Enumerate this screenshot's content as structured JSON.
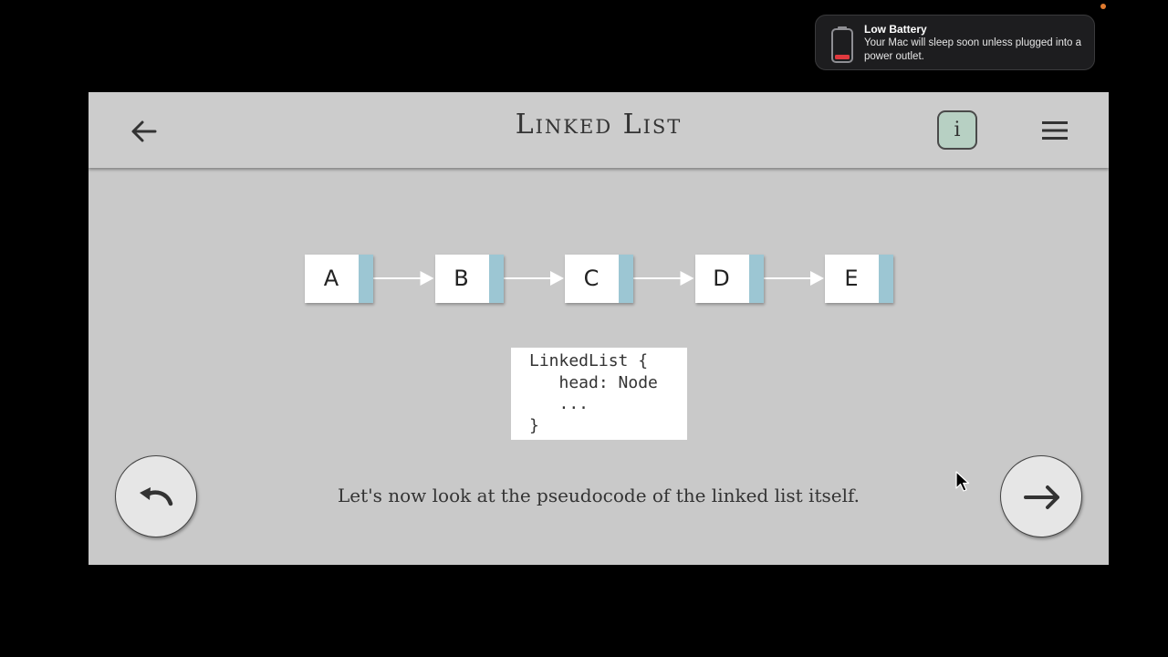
{
  "notification": {
    "title": "Low Battery",
    "body": "Your Mac will sleep soon unless plugged into a power outlet.",
    "icon": "battery-low-icon",
    "battery_color": "#e0393e"
  },
  "header": {
    "title": "Linked List",
    "back_icon": "arrow-left-icon",
    "info_label": "i",
    "menu_icon": "hamburger-menu-icon",
    "info_color": "#b7d0c3"
  },
  "linked_list": {
    "nodes": [
      "A",
      "B",
      "C",
      "D",
      "E"
    ],
    "pointer_color": "#9cc6d3"
  },
  "code": {
    "lines": [
      "LinkedList {",
      "   head: Node",
      "   ...",
      "}"
    ]
  },
  "caption": "Let's now look at the pseudocode of the linked list itself.",
  "controls": {
    "undo_icon": "undo-arrow-icon",
    "next_icon": "arrow-right-icon"
  }
}
